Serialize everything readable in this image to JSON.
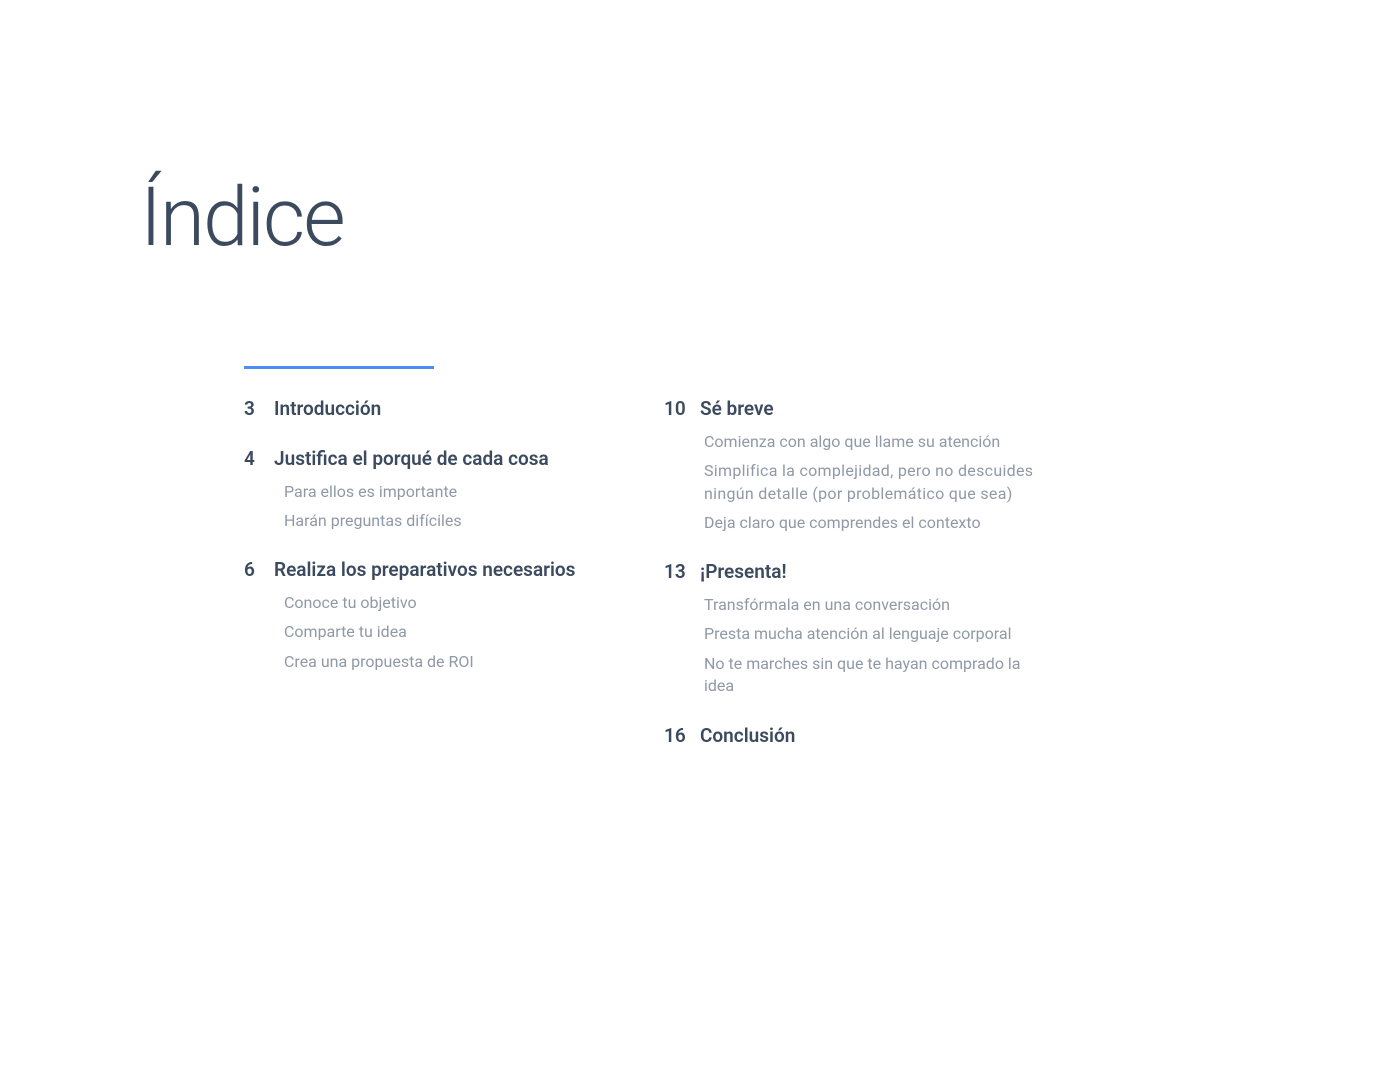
{
  "document": {
    "title": "Índice"
  },
  "toc": {
    "left": [
      {
        "page": "3",
        "title": "Introducción",
        "subs": []
      },
      {
        "page": "4",
        "title": "Justifica el porqué de cada cosa",
        "subs": [
          "Para ellos es importante",
          "Harán preguntas difíciles"
        ]
      },
      {
        "page": "6",
        "title": "Realiza los preparativos necesarios",
        "subs": [
          "Conoce tu objetivo",
          "Comparte tu idea",
          "Crea una propuesta de ROI"
        ]
      }
    ],
    "right": [
      {
        "page": "10",
        "title": "Sé breve",
        "subs": [
          "Comienza con algo que llame su atención",
          "Simplifica la complejidad, pero no descuides ningún detalle (por problemático que sea)",
          "Deja claro que comprendes el contexto"
        ]
      },
      {
        "page": "13",
        "title": "¡Presenta!",
        "subs": [
          "Transfórmala en una conversación",
          "Presta mucha atención al lenguaje corporal",
          "No te marches sin que te hayan comprado la idea"
        ]
      },
      {
        "page": "16",
        "title": "Conclusión",
        "subs": []
      }
    ]
  }
}
